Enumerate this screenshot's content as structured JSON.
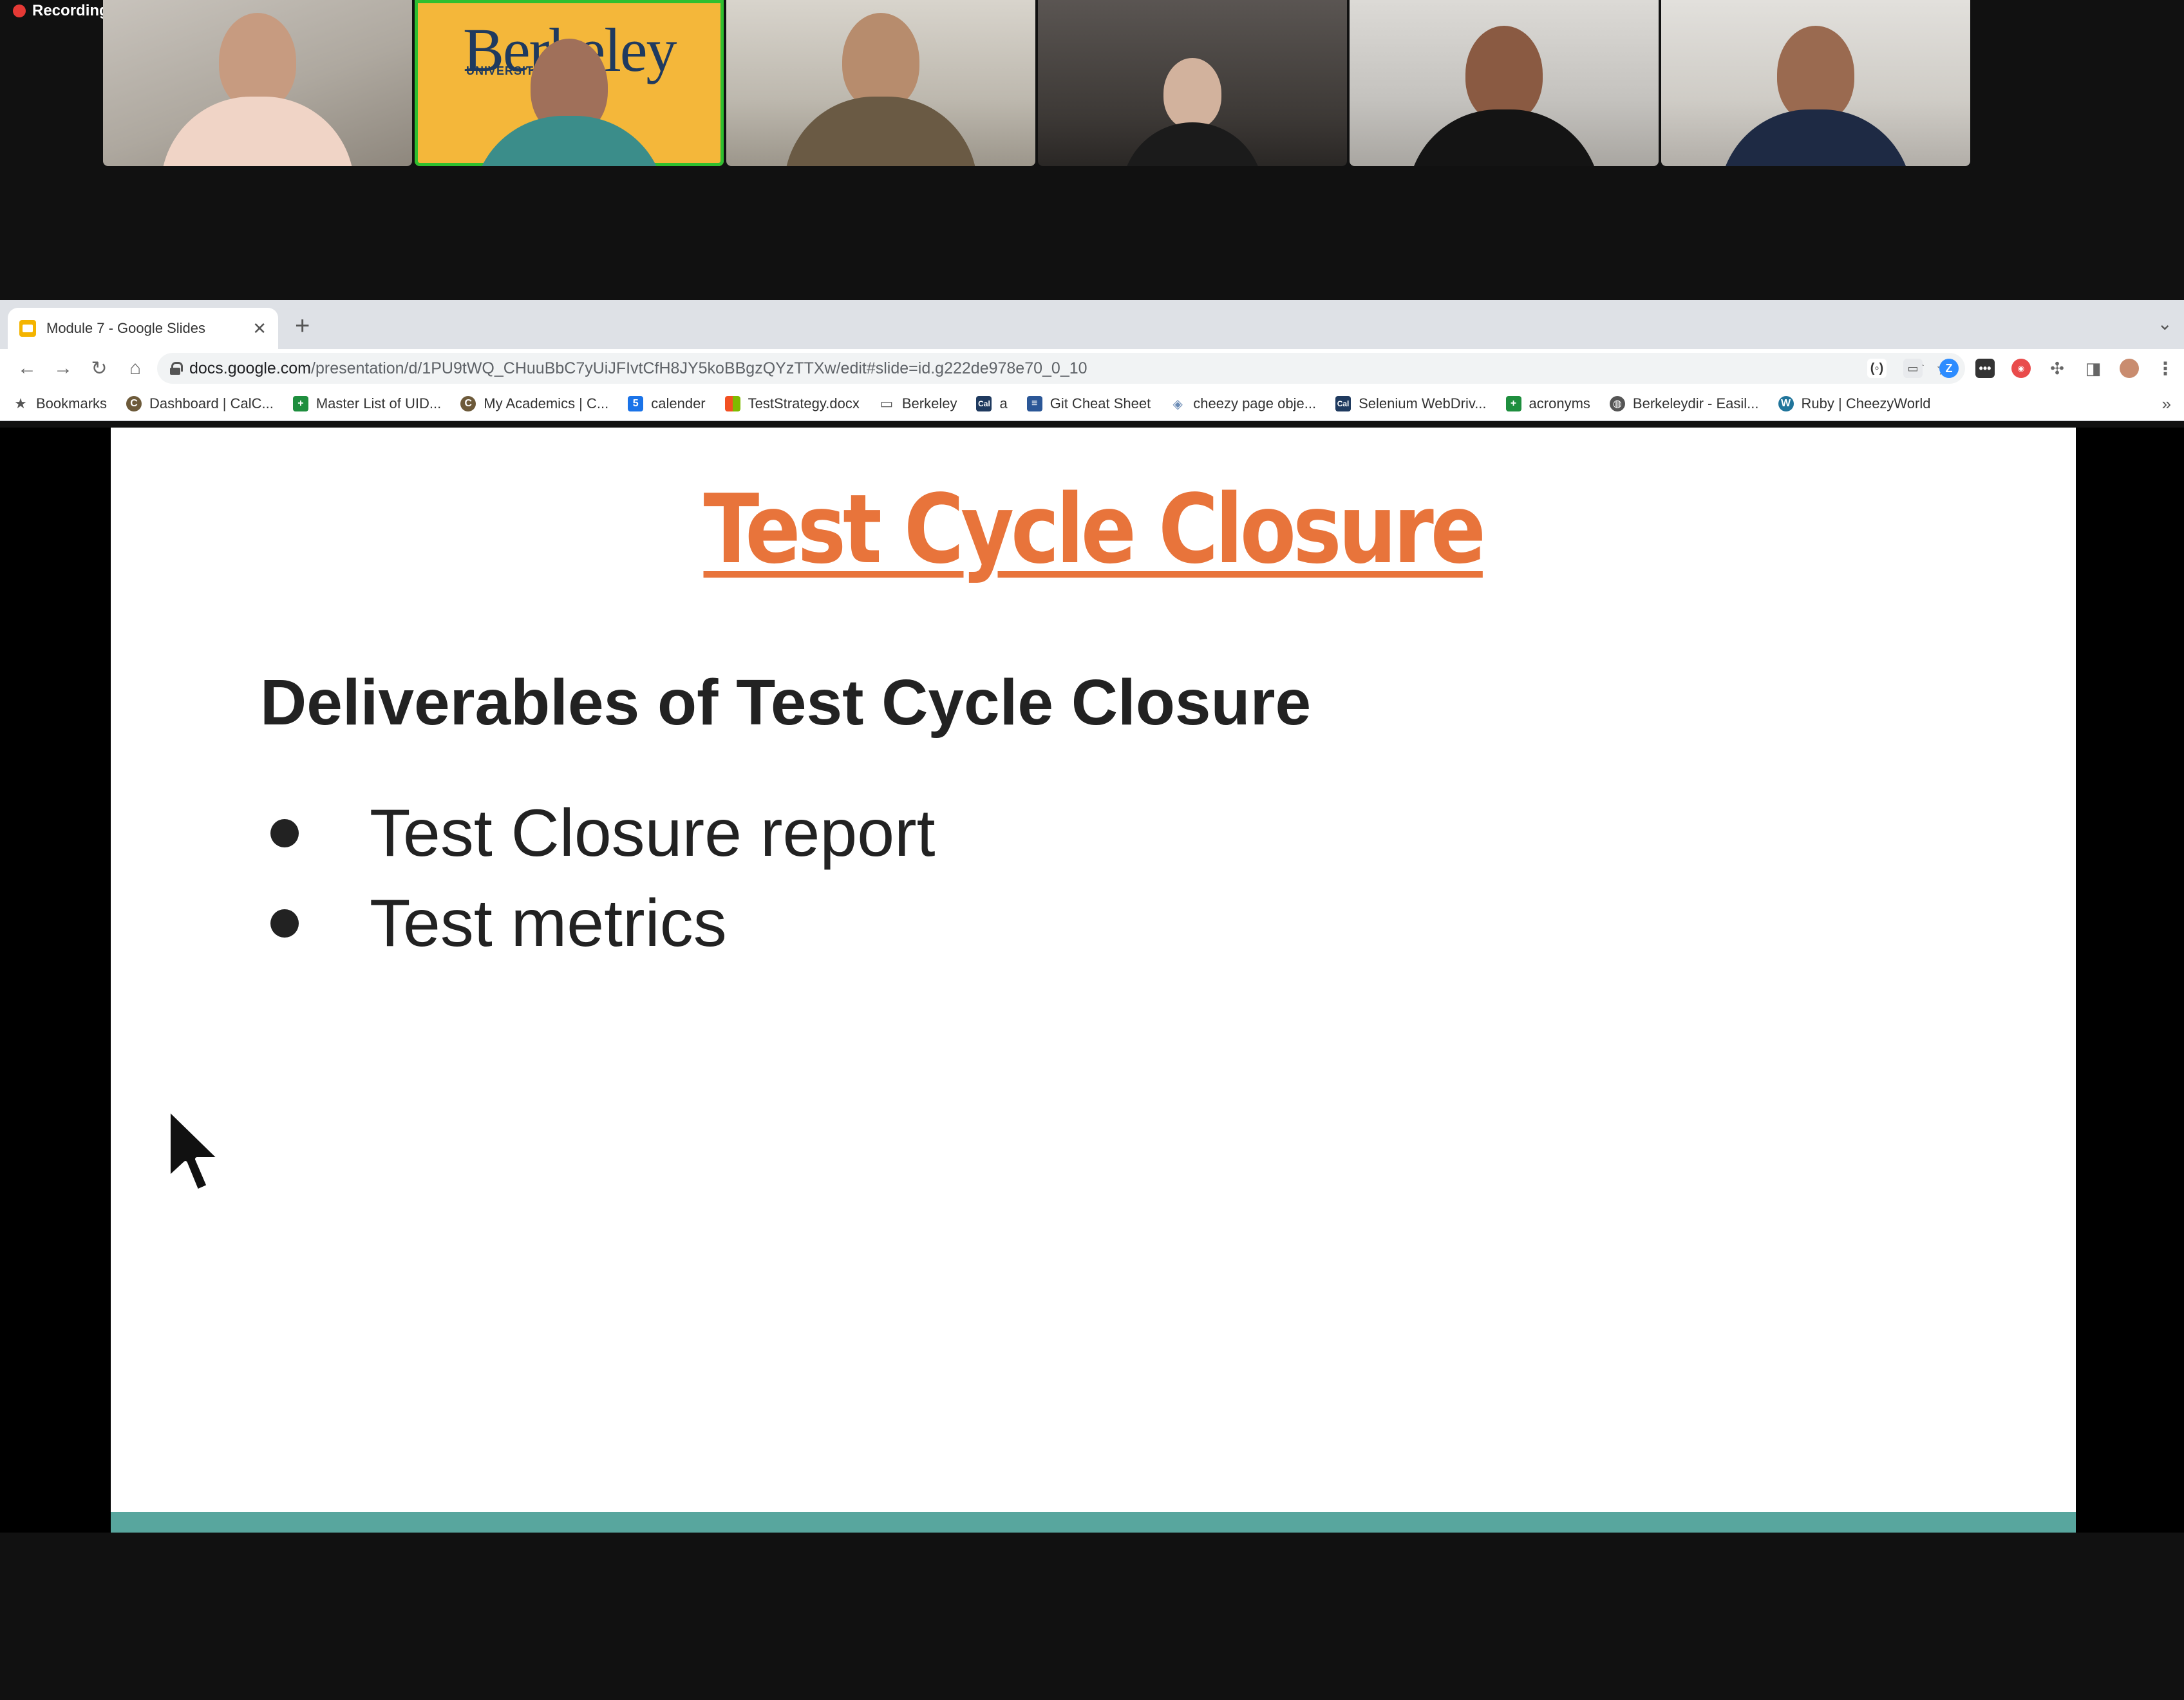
{
  "meeting": {
    "recording_label": "Recording",
    "participants": [
      {
        "id": "p1",
        "active": false
      },
      {
        "id": "p2",
        "active": true,
        "background_text": "Berkeley",
        "background_subtext": "UNIVERSITY OF"
      },
      {
        "id": "p3",
        "active": false
      },
      {
        "id": "p4",
        "active": false
      },
      {
        "id": "p5",
        "active": false
      },
      {
        "id": "p6",
        "active": false
      }
    ]
  },
  "browser": {
    "tab_title": "Module 7 - Google Slides",
    "url_host": "docs.google.com",
    "url_path": "/presentation/d/1PU9tWQ_CHuuBbC7yUiJFIvtCfH8JY5koBBgzQYzTTXw/edit#slide=id.g222de978e70_0_10",
    "bookmarks": [
      {
        "label": "Bookmarks",
        "icon": "star-icon"
      },
      {
        "label": "Dashboard | CalC...",
        "icon": "c-icon"
      },
      {
        "label": "Master List of UID...",
        "icon": "sheets-icon"
      },
      {
        "label": "My Academics | C...",
        "icon": "c-icon"
      },
      {
        "label": "calender",
        "icon": "calendar-icon"
      },
      {
        "label": "TestStrategy.docx",
        "icon": "ms-icon"
      },
      {
        "label": "Berkeley",
        "icon": "folder-icon"
      },
      {
        "label": "a",
        "icon": "cal-icon"
      },
      {
        "label": "Git Cheat Sheet",
        "icon": "git-icon"
      },
      {
        "label": "cheezy page obje...",
        "icon": "page-icon"
      },
      {
        "label": "Selenium WebDriv...",
        "icon": "cal-icon"
      },
      {
        "label": "acronyms",
        "icon": "sheets-icon"
      },
      {
        "label": "Berkeleydir - Easil...",
        "icon": "globe-icon"
      },
      {
        "label": "Ruby | CheezyWorld",
        "icon": "wordpress-icon"
      }
    ],
    "bookmarks_more": "»"
  },
  "slide": {
    "title": "Test Cycle Closure",
    "heading": "Deliverables of Test Cycle Closure",
    "bullets": [
      "Test Closure report",
      "Test metrics"
    ],
    "colors": {
      "title": "#e8743b",
      "footer_bar": "#58a69e"
    }
  }
}
